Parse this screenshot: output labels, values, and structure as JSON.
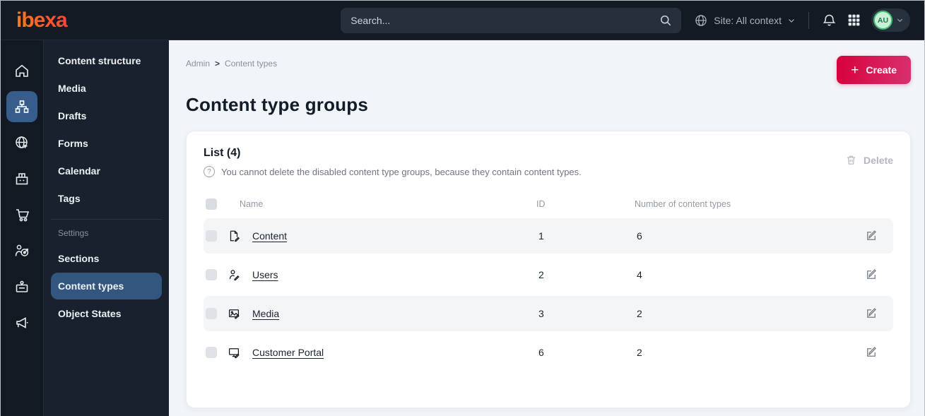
{
  "topbar": {
    "logo_text": "ibexa",
    "search_placeholder": "Search...",
    "site_selector_label": "Site: All context",
    "avatar_initials": "AU"
  },
  "rail": {
    "icons": [
      "home",
      "content-structure",
      "site",
      "products",
      "commerce-cart",
      "personalization",
      "publish-board",
      "campaign-megaphone"
    ],
    "active_icon": "content-structure"
  },
  "sidebar": {
    "items": [
      {
        "label": "Content structure"
      },
      {
        "label": "Media"
      },
      {
        "label": "Drafts"
      },
      {
        "label": "Forms"
      },
      {
        "label": "Calendar"
      },
      {
        "label": "Tags"
      }
    ],
    "section_label": "Settings",
    "settings_items": [
      {
        "label": "Sections"
      },
      {
        "label": "Content types"
      },
      {
        "label": "Object States"
      }
    ],
    "active_item": "Content types"
  },
  "page": {
    "breadcrumb": {
      "0": "Admin",
      "separator": ">",
      "1": "Content types"
    },
    "title": "Content type groups",
    "create_label": "Create",
    "create_plus": "+"
  },
  "list": {
    "title": "List (4)",
    "info_icon": "?",
    "info_text": "You cannot delete the disabled content type groups, because they contain content types.",
    "delete_label": "Delete",
    "columns": {
      "name": "Name",
      "id": "ID",
      "count": "Number of content types"
    },
    "rows": [
      {
        "icon": "content-file-icon",
        "name": "Content",
        "id": "1",
        "count": "6"
      },
      {
        "icon": "users-icon",
        "name": "Users",
        "id": "2",
        "count": "4"
      },
      {
        "icon": "media-image-icon",
        "name": "Media",
        "id": "3",
        "count": "2"
      },
      {
        "icon": "monitor-icon",
        "name": "Customer Portal",
        "id": "6",
        "count": "2"
      }
    ]
  },
  "colors": {
    "topbar_bg": "#131a24",
    "active_blue": "#365d8c",
    "active_menu_pill": "#33567e",
    "create_gradient_start": "#d7013c",
    "create_gradient_end": "#d8306f",
    "avatar_green_ring": "#3fbf71",
    "avatar_green_bg": "#c9efd6",
    "main_bg": "#f1f4f8",
    "row_stripe": "#f4f5f7"
  }
}
